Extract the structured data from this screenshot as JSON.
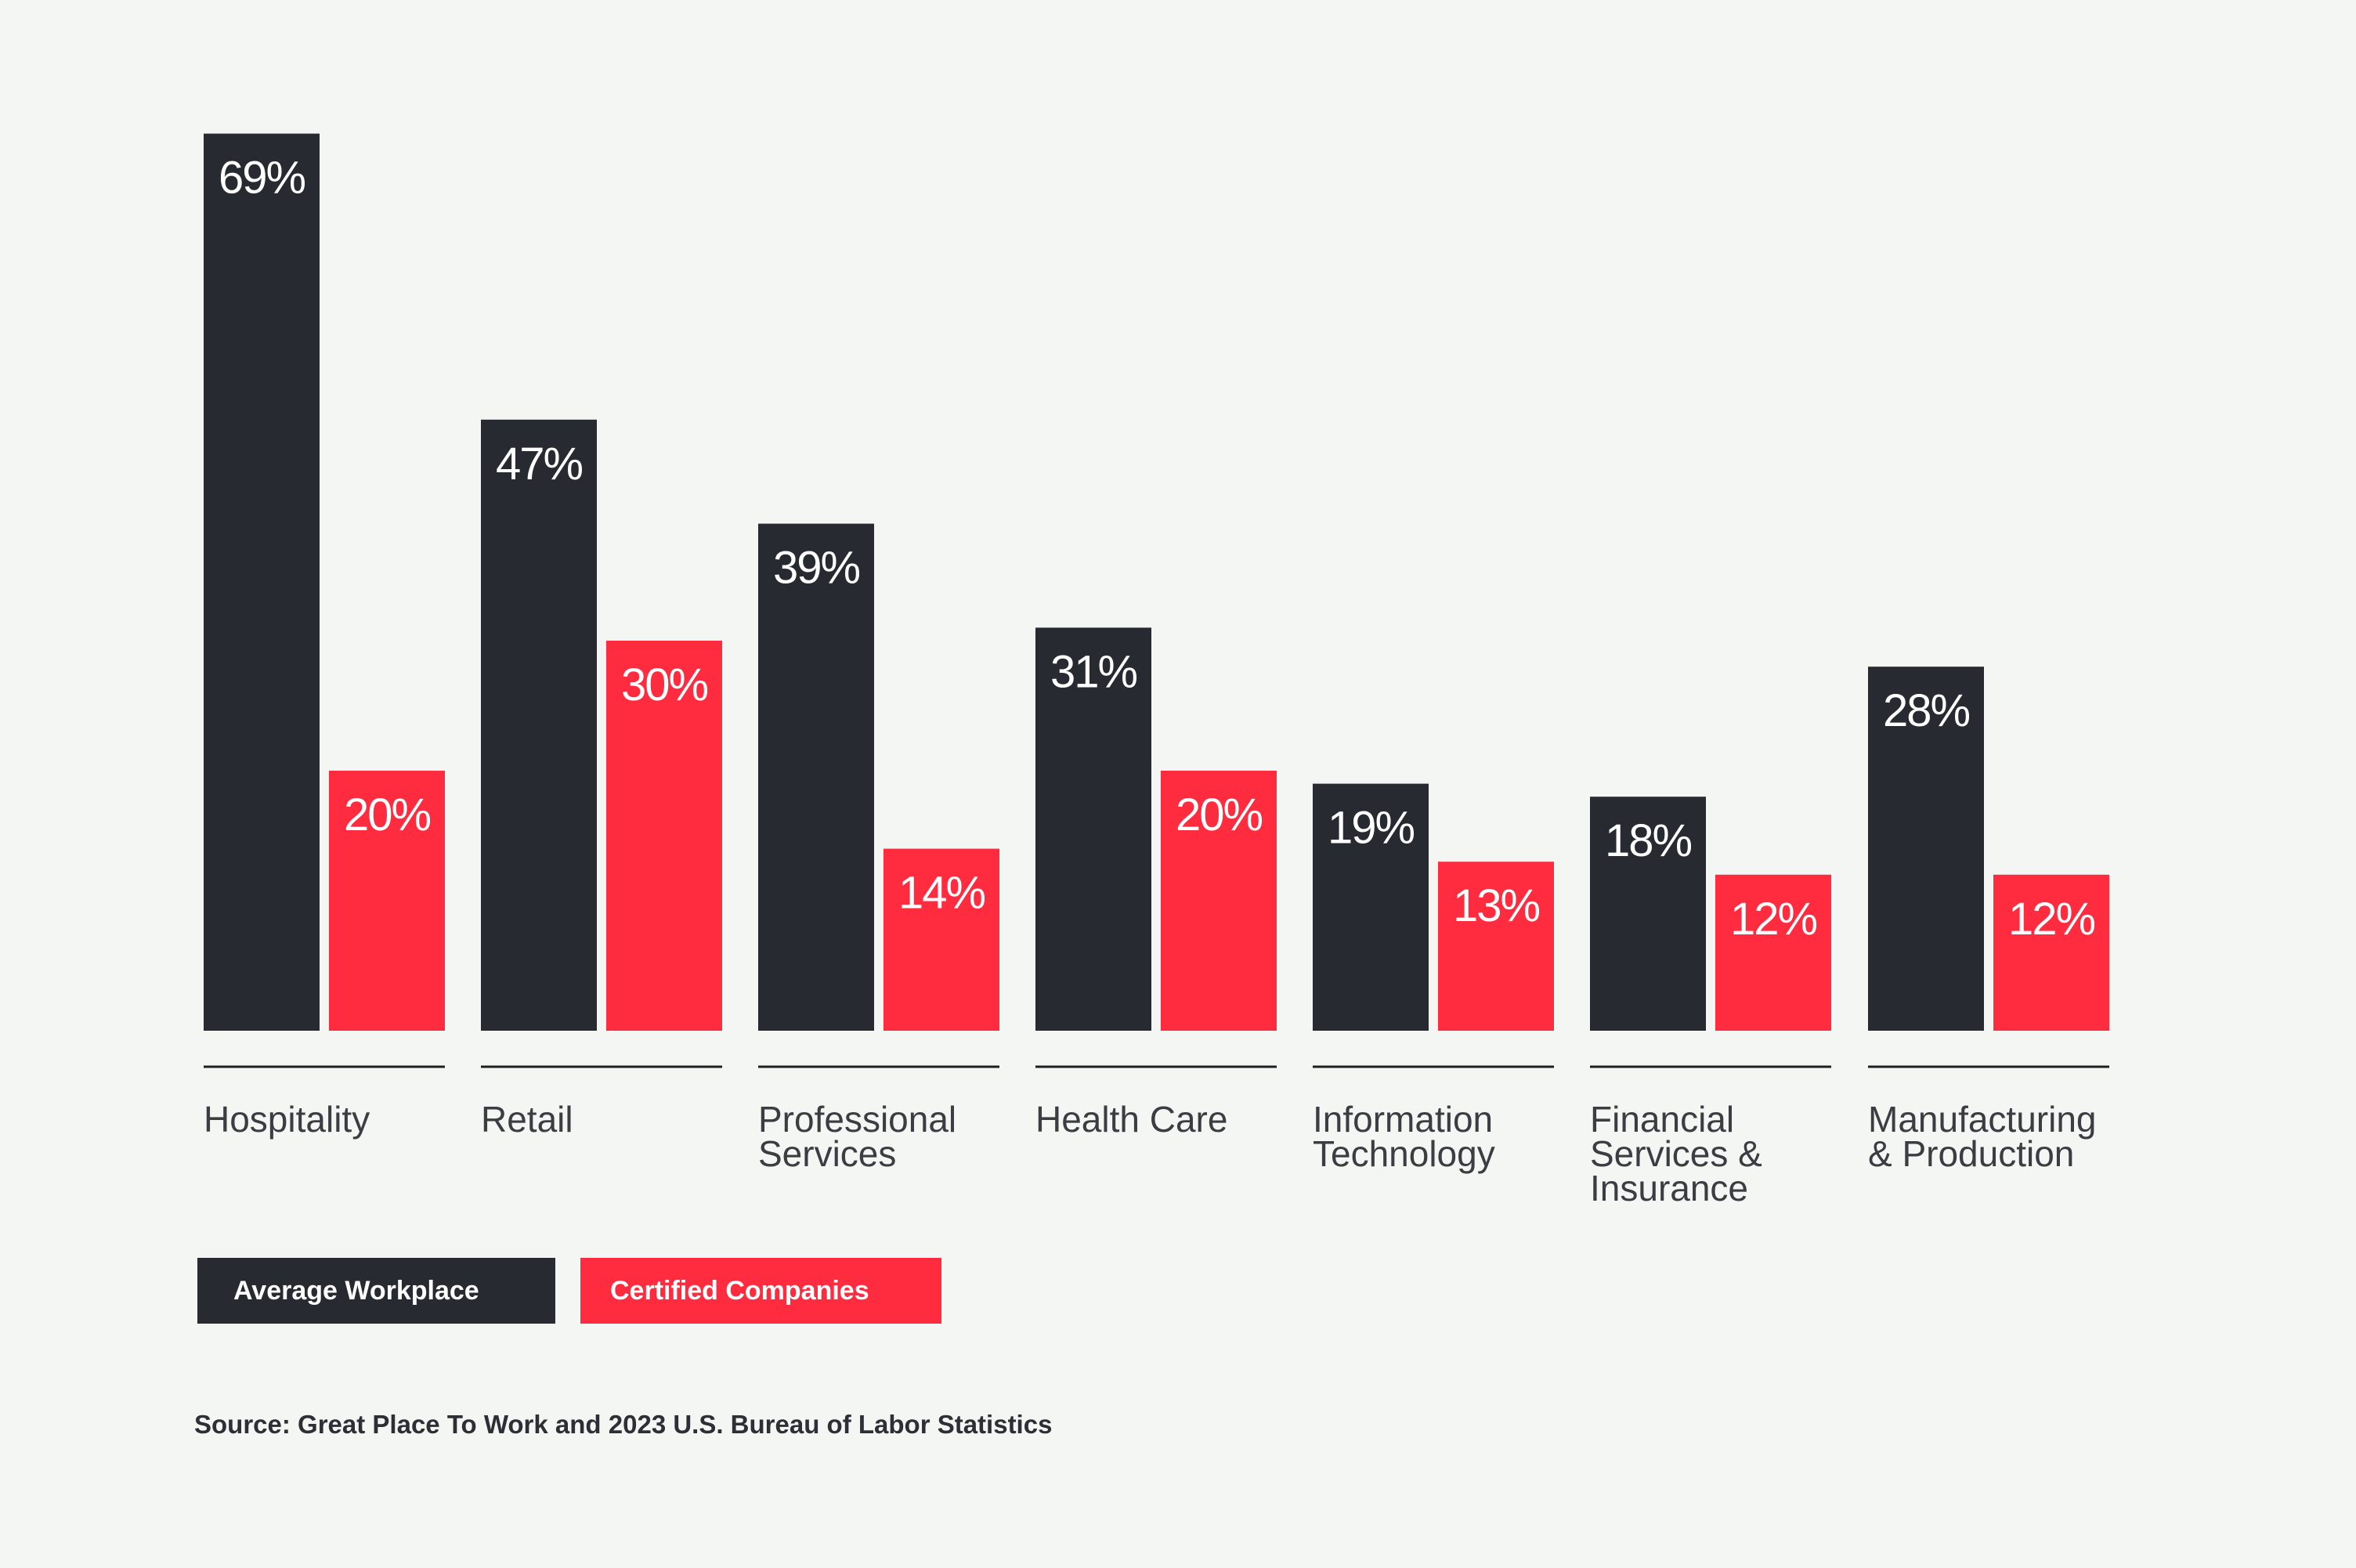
{
  "chart_data": {
    "type": "bar",
    "title": "",
    "xlabel": "",
    "ylabel": "",
    "ylim": [
      0,
      70
    ],
    "grid": false,
    "legend_position": "bottom-left",
    "categories": [
      [
        "Hospitality"
      ],
      [
        "Retail"
      ],
      [
        "Professional",
        "Services"
      ],
      [
        "Health Care"
      ],
      [
        "Information",
        "Technology"
      ],
      [
        "Financial",
        "Services &",
        "Insurance"
      ],
      [
        "Manufacturing",
        "& Production"
      ]
    ],
    "series": [
      {
        "name": "Average Workplace",
        "color": "#272a31",
        "values": [
          69,
          47,
          39,
          31,
          19,
          18,
          28
        ]
      },
      {
        "name": "Certified Companies",
        "color": "#ff2b3f",
        "values": [
          20,
          30,
          14,
          20,
          13,
          12,
          12
        ]
      }
    ],
    "value_suffix": "%",
    "source": "Source: Great Place To Work and 2023 U.S. Bureau of Labor Statistics"
  },
  "legend": {
    "avg_label": "Average Workplace",
    "cert_label": "Certified Companies"
  },
  "colors": {
    "background": "#f4f6f3",
    "dark": "#272a31",
    "red": "#ff2b3f",
    "axis": "#1c1e22"
  }
}
